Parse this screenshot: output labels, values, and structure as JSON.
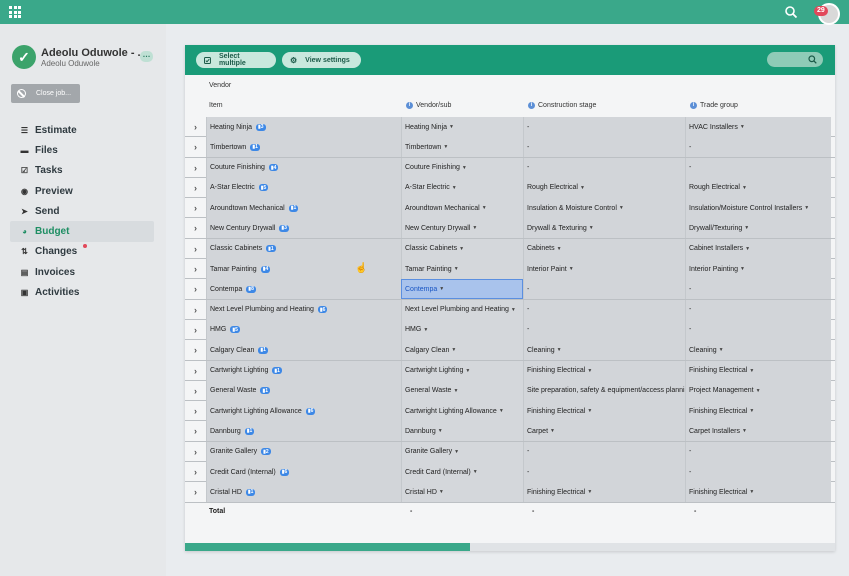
{
  "topbar": {
    "notifications": "29"
  },
  "user": {
    "name": "Adeolu Oduwole - ...",
    "sub": "Adeolu Oduwole"
  },
  "close_job": "Close job...",
  "nav": [
    {
      "label": "Estimate",
      "icon": "list-icon"
    },
    {
      "label": "Files",
      "icon": "folder-icon"
    },
    {
      "label": "Tasks",
      "icon": "checkbox-icon"
    },
    {
      "label": "Preview",
      "icon": "eye-icon"
    },
    {
      "label": "Send",
      "icon": "send-icon"
    },
    {
      "label": "Budget",
      "icon": "pie-icon",
      "active": true
    },
    {
      "label": "Changes",
      "icon": "changes-icon"
    },
    {
      "label": "Invoices",
      "icon": "invoice-icon"
    },
    {
      "label": "Activities",
      "icon": "activity-icon"
    }
  ],
  "toolbar": {
    "select_multiple": "Select multiple",
    "view_settings": "View settings"
  },
  "table": {
    "group_label": "Vendor",
    "headers": [
      "Item",
      "Vendor/sub",
      "Construction stage",
      "Trade group"
    ],
    "rows": [
      {
        "item": "Heating Ninja",
        "badge": "3",
        "vendor": "Heating Ninja",
        "stage": "-",
        "trade": "HVAC Installers"
      },
      {
        "item": "Timbertown",
        "badge": "1",
        "vendor": "Timbertown",
        "stage": "-",
        "trade": "-"
      },
      {
        "item": "Couture Finishing",
        "badge": "4",
        "vendor": "Couture Finishing",
        "stage": "-",
        "trade": "-"
      },
      {
        "item": "A-Star Electric",
        "badge": "5",
        "vendor": "A-Star Electric",
        "stage": "Rough Electrical",
        "trade": "Rough Electrical"
      },
      {
        "item": "Aroundtown Mechanical",
        "badge": "1",
        "vendor": "Aroundtown Mechanical",
        "stage": "Insulation & Moisture Control",
        "trade": "Insulation/Moisture Control Installers"
      },
      {
        "item": "New Century Drywall",
        "badge": "3",
        "vendor": "New Century Drywall",
        "stage": "Drywall & Texturing",
        "trade": "Drywall/Texturing"
      },
      {
        "item": "Classic Cabinets",
        "badge": "1",
        "vendor": "Classic Cabinets",
        "stage": "Cabinets",
        "trade": "Cabinet Installers"
      },
      {
        "item": "Tamar Painting",
        "badge": "4",
        "vendor": "Tamar Painting",
        "stage": "Interior Paint",
        "trade": "Interior Painting"
      },
      {
        "item": "Contempa",
        "badge": "8",
        "vendor": "Contempa",
        "stage": "-",
        "trade": "-",
        "selected": true
      },
      {
        "item": "Next Level Plumbing and Heating",
        "badge": "6",
        "vendor": "Next Level Plumbing and Heating",
        "stage": "-",
        "trade": "-"
      },
      {
        "item": "HMG",
        "badge": "5",
        "vendor": "HMG",
        "stage": "-",
        "trade": "-"
      },
      {
        "item": "Calgary Clean",
        "badge": "1",
        "vendor": "Calgary Clean",
        "stage": "Cleaning",
        "trade": "Cleaning"
      },
      {
        "item": "Cartwright Lighting",
        "badge": "1",
        "vendor": "Cartwright Lighting",
        "stage": "Finishing Electrical",
        "trade": "Finishing Electrical"
      },
      {
        "item": "General Waste",
        "badge": "1",
        "vendor": "General Waste",
        "stage": "Site preparation, safety & equipment/access planni",
        "trade": "Project Management"
      },
      {
        "item": "Cartwright Lighting Allowance",
        "badge": "6",
        "vendor": "Cartwright Lighting Allowance",
        "stage": "Finishing Electrical",
        "trade": "Finishing Electrical"
      },
      {
        "item": "Dannburg",
        "badge": "1",
        "vendor": "Dannburg",
        "stage": "Carpet",
        "trade": "Carpet Installers"
      },
      {
        "item": "Granite Gallery",
        "badge": "2",
        "vendor": "Granite Gallery",
        "stage": "-",
        "trade": "-"
      },
      {
        "item": "Credit Card (Internal)",
        "badge": "6",
        "vendor": "Credit Card (Internal)",
        "stage": "-",
        "trade": "-"
      },
      {
        "item": "Cristal HD",
        "badge": "1",
        "vendor": "Cristal HD",
        "stage": "Finishing Electrical",
        "trade": "Finishing Electrical"
      }
    ],
    "total": {
      "label": "Total",
      "vendor": "-",
      "stage": "-",
      "trade": "-"
    }
  },
  "colors": {
    "brand": "#3aa88a",
    "toolbar": "#1a9b78",
    "badge": "#3d88e6"
  }
}
